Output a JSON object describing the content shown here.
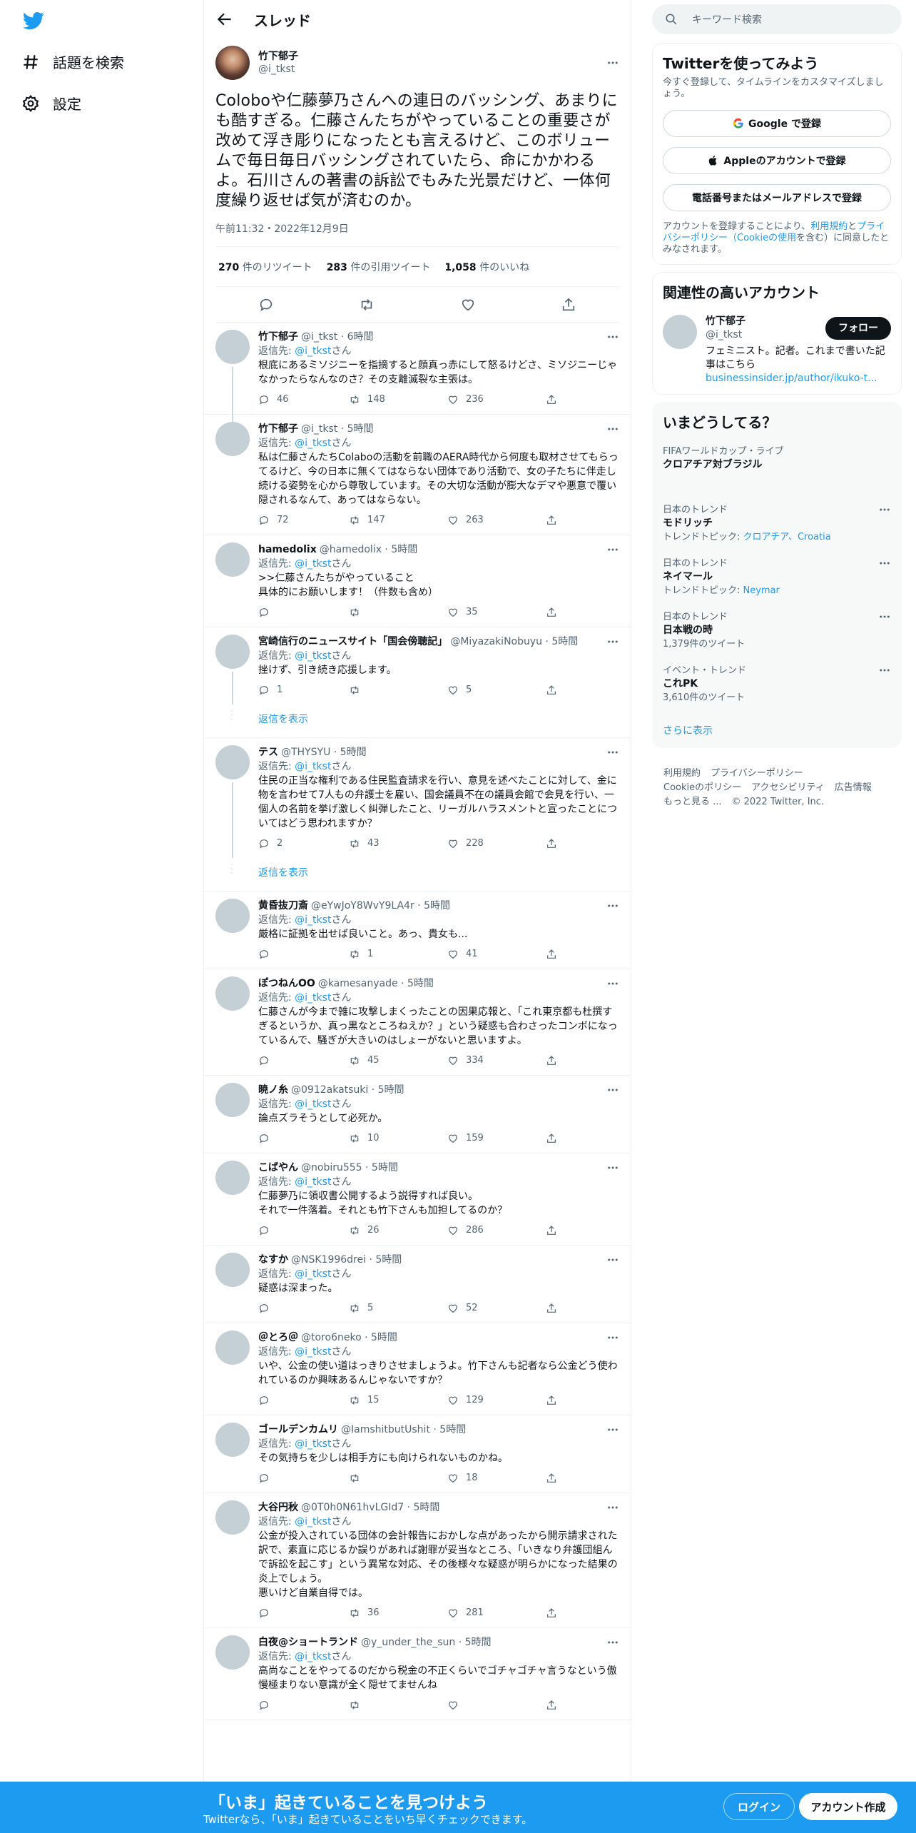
{
  "nav": {
    "explore_label": "話題を検索",
    "settings_label": "設定"
  },
  "header": {
    "title": "スレッド"
  },
  "main_tweet": {
    "name": "竹下郁子",
    "handle": "@i_tkst",
    "text": "Coloboや仁藤夢乃さんへの連日のバッシング、あまりにも酷すぎる。仁藤さんたちがやっていることの重要さが改めて浮き彫りになったとも言えるけど、このボリュームで毎日毎日バッシングされていたら、命にかかわるよ。石川さんの著書の訴訟でもみた光景だけど、一体何度繰り返せば気が済むのか。",
    "time": "午前11:32・2022年12月9日",
    "retweets": "270",
    "retweets_label": "件のリツイート",
    "quotes": "283",
    "quotes_label": "件の引用ツイート",
    "likes": "1,058",
    "likes_label": "件のいいね"
  },
  "reply_prefix": "返信先:",
  "reply_suffix": "さん",
  "show_replies": "返信を表示",
  "replies": [
    {
      "name": "竹下郁子",
      "handle": "@i_tkst · 6時間",
      "to": "@i_tkst",
      "text": "根底にあるミソジニーを指摘すると顔真っ赤にして怒るけどさ、ミソジニーじゃなかったらなんなのさ？その支離滅裂な主張は。",
      "replies": "46",
      "retweets": "148",
      "likes": "236"
    },
    {
      "name": "竹下郁子",
      "handle": "@i_tkst · 5時間",
      "to": "@i_tkst",
      "text": "私は仁藤さんたちColaboの活動を前職のAERA時代から何度も取材させてもらってるけど、今の日本に無くてはならない団体であり活動で、女の子たちに伴走し続ける姿勢を心から尊敬しています。その大切な活動が膨大なデマや悪意で覆い隠されるなんて、あってはならない。",
      "replies": "72",
      "retweets": "147",
      "likes": "263"
    },
    {
      "name": "hamedolix",
      "handle": "@hamedolix · 5時間",
      "to": "@i_tkst",
      "text": ">>仁藤さんたちがやっていること\n具体的にお願いします！（件数も含め）",
      "replies": "",
      "retweets": "",
      "likes": "35"
    },
    {
      "name": "宮崎信行のニュースサイト「国会傍聴記」",
      "handle": "@MiyazakiNobuyu · 5時間",
      "to": "@i_tkst",
      "text": "挫けず、引き続き応援します。",
      "replies": "1",
      "retweets": "",
      "likes": "5"
    },
    {
      "name": "テス",
      "handle": "@THYSYU · 5時間",
      "to": "@i_tkst",
      "text": "住民の正当な権利である住民監査請求を行い、意見を述べたことに対して、金に物を言わせて7人もの弁護士を雇い、国会議員不在の議員会館で会見を行い、一個人の名前を挙げ激しく糾弾したこと、リーガルハラスメントと宣ったことについてはどう思われますか？",
      "replies": "2",
      "retweets": "43",
      "likes": "228"
    },
    {
      "name": "黄昏抜刀斎",
      "handle": "@eYwJoY8WvY9LA4r · 5時間",
      "to": "@i_tkst",
      "text": "厳格に証拠を出せば良いこと。あっ、貴女も...",
      "replies": "",
      "retweets": "1",
      "likes": "41"
    },
    {
      "name": "ぽつねんOO",
      "handle": "@kamesanyade · 5時間",
      "to": "@i_tkst",
      "text": "仁藤さんが今まで雑に攻撃しまくったことの因果応報と、「これ東京都も杜撰すぎるというか、真っ黒なところねえか？」という疑惑も合わさったコンボになっているんで、騒ぎが大きいのはしょーがないと思いますよ。",
      "replies": "",
      "retweets": "45",
      "likes": "334"
    },
    {
      "name": "暁ノ糸",
      "handle": "@0912akatsuki · 5時間",
      "to": "@i_tkst",
      "text": "論点ズラそうとして必死か。",
      "replies": "",
      "retweets": "10",
      "likes": "159"
    },
    {
      "name": "こばやん",
      "handle": "@nobiru555 · 5時間",
      "to": "@i_tkst",
      "text": "仁藤夢乃に領収書公開するよう説得すれば良い。\nそれで一件落着。それとも竹下さんも加担してるのか？",
      "replies": "",
      "retweets": "26",
      "likes": "286"
    },
    {
      "name": "なすか",
      "handle": "@NSK1996drei · 5時間",
      "to": "@i_tkst",
      "text": "疑惑は深まった。",
      "replies": "",
      "retweets": "5",
      "likes": "52"
    },
    {
      "name": "＠とろ＠",
      "handle": "@toro6neko · 5時間",
      "to": "@i_tkst",
      "text": "いや、公金の使い道はっきりさせましょうよ。竹下さんも記者なら公金どう使われているのか興味あるんじゃないですか？",
      "replies": "",
      "retweets": "15",
      "likes": "129"
    },
    {
      "name": "ゴールデンカムリ",
      "handle": "@IamshitbutUshit · 5時間",
      "to": "@i_tkst",
      "text": "その気持ちを少しは相手方にも向けられないものかね。",
      "replies": "",
      "retweets": "",
      "likes": "18"
    },
    {
      "name": "大谷円秋",
      "handle": "@0T0h0N61hvLGId7 · 5時間",
      "to": "@i_tkst",
      "text": "公金が投入されている団体の会計報告におかしな点があったから開示請求された訳で、素直に応じるか誤りがあれば謝罪が妥当なところ、「いきなり弁護団組んで訴訟を起こす」という異常な対応、その後様々な疑惑が明らかになった結果の炎上でしょう。\n悪いけど自業自得では。",
      "replies": "",
      "retweets": "36",
      "likes": "281"
    },
    {
      "name": "白夜@ショートランド",
      "handle": "@y_under_the_sun · 5時間",
      "to": "@i_tkst",
      "text": "高尚なことをやってるのだから税金の不正くらいでゴチャゴチャ言うなという傲慢極まりない意識が全く隠せてませんね",
      "replies": "",
      "retweets": "",
      "likes": ""
    }
  ],
  "sidebar": {
    "search_placeholder": "キーワード検索",
    "signup": {
      "title": "Twitterを使ってみよう",
      "sub": "今すぐ登録して、タイムラインをカスタマイズしましょう。",
      "google": "Google で登録",
      "apple": "Appleのアカウントで登録",
      "phone": "電話番号またはメールアドレスで登録",
      "terms_a": "アカウントを登録することにより、",
      "terms_link1": "利用規約",
      "terms_b": "と",
      "terms_link2": "プライバシーポリシー（Cookieの使用",
      "terms_c": "を含む）に同意したとみなされます。"
    },
    "related": {
      "title": "関連性の高いアカウント",
      "name": "竹下郁子",
      "handle": "@i_tkst",
      "follow": "フォロー",
      "bio": "フェミニスト。記者。これまで書いた記事はこちら",
      "link": "businessinsider.jp/author/ikuko-t..."
    },
    "trends": {
      "title": "いまどうしてる？",
      "items": [
        {
          "cat": "FIFAワールドカップ・ライブ",
          "name": "クロアチア対ブラジル",
          "extra": ""
        },
        {
          "cat": "日本のトレンド",
          "name": "モドリッチ",
          "extra_label": "トレンドトピック: ",
          "extra": "クロアチア、Croatia"
        },
        {
          "cat": "日本のトレンド",
          "name": "ネイマール",
          "extra_label": "トレンドトピック: ",
          "extra": "Neymar"
        },
        {
          "cat": "日本のトレンド",
          "name": "日本戦の時",
          "count": "1,379件のツイート"
        },
        {
          "cat": "イベント・トレンド",
          "name": "これPK",
          "count": "3,610件のツイート"
        }
      ],
      "show_more": "さらに表示"
    },
    "footer": {
      "l1": "利用規約",
      "l2": "プライバシーポリシー",
      "l3": "Cookieのポリシー",
      "l4": "アクセシビリティ",
      "l5": "広告情報",
      "l6": "もっと見る ...",
      "copy": "© 2022 Twitter, Inc."
    }
  },
  "bottom": {
    "title": "「いま」起きていることを見つけよう",
    "sub": "Twitterなら、「いま」起きていることをいち早くチェックできます。",
    "login": "ログイン",
    "signup": "アカウント作成"
  },
  "colors": {
    "accent": "#1d9bf0",
    "text": "#0f1419",
    "muted": "#536471"
  }
}
